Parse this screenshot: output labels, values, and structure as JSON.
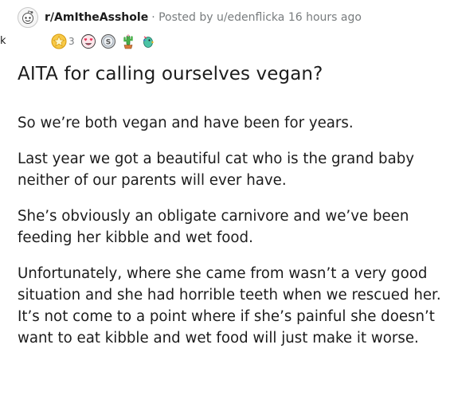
{
  "edge_glyph": "k",
  "post": {
    "subreddit": "r/AmItheAsshole",
    "meta": "· Posted by u/edenflicka 16 hours ago",
    "awards": [
      {
        "icon": "gold-star-award",
        "color": "#f2b418",
        "count": "3"
      },
      {
        "icon": "heart-eyes-award",
        "color": "#e8345a"
      },
      {
        "icon": "silver-coin-award",
        "color": "#8e9aa6"
      },
      {
        "icon": "cactus-award",
        "color": "#3d9a3a"
      },
      {
        "icon": "party-parrot-award",
        "color": "#31a38a"
      }
    ],
    "title": "AITA for calling ourselves vegan?",
    "paragraphs": [
      "So we’re both vegan and have been for years.",
      "Last year we got a beautiful cat who is the grand baby neither of our parents will ever have.",
      "She’s obviously an obligate carnivore and we’ve been feeding her kibble and wet food.",
      "Unfortunately, where she came from wasn’t a very good situation and she had horrible teeth when we rescued her. It’s not come to a point where if she’s painful she doesn’t want to eat kibble and wet food will just make it worse."
    ]
  }
}
